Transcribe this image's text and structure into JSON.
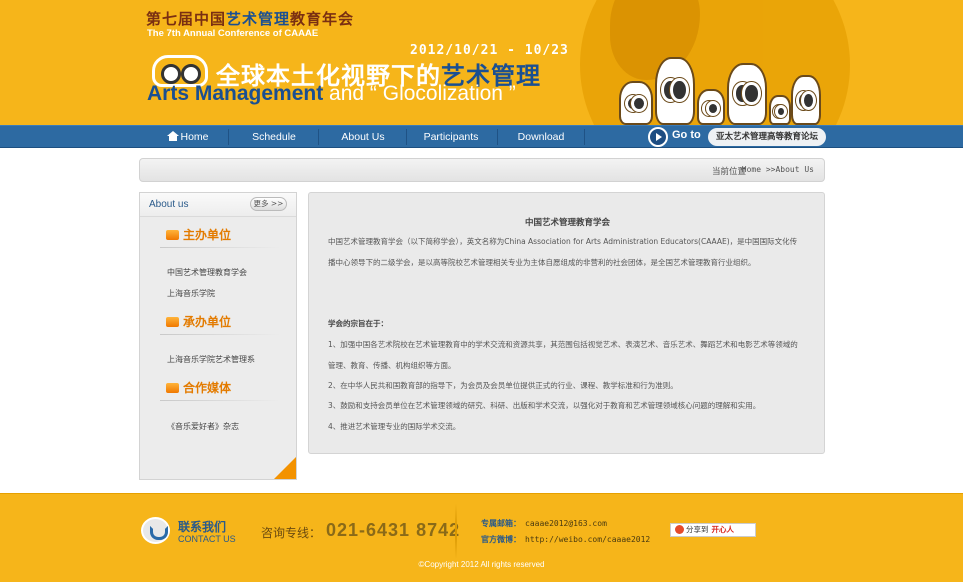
{
  "banner": {
    "title_cn_pre": "第七届中国",
    "title_cn_hl": "艺术管理",
    "title_cn_post": "教育年会",
    "title_en": "The 7th Annual Conference of CAAAE",
    "date": "2012/10/21 - 10/23",
    "theme_cn_pre": "全球本土化视野下的",
    "theme_cn_hl": "艺术管理",
    "theme_en_main": "Arts Management",
    "theme_en_rest": "and “ Glocolization ”"
  },
  "nav": {
    "items": [
      {
        "label": "Home"
      },
      {
        "label": "Schedule"
      },
      {
        "label": "About Us"
      },
      {
        "label": "Participants"
      },
      {
        "label": "Download"
      }
    ],
    "goto_label": "Go to",
    "goto_link": "亚太艺术管理高等教育论坛"
  },
  "breadcrumb": {
    "prefix": "当前位置",
    "path": "Home >>About Us"
  },
  "sidebar": {
    "title": "About us",
    "more": "更多 >>",
    "sections": [
      {
        "title": "主办单位",
        "items": [
          "中国艺术管理教育学会",
          "上海音乐学院"
        ]
      },
      {
        "title": "承办单位",
        "items": [
          "上海音乐学院艺术管理系"
        ]
      },
      {
        "title": "合作媒体",
        "items": [
          "《音乐爱好者》杂志"
        ]
      }
    ]
  },
  "content": {
    "title": "中国艺术管理教育学会",
    "intro": "中国艺术管理教育学会（以下简称学会），英文名称为China Association for Arts Administration Educators(CAAAE)，是中国国际文化传播中心领导下的二级学会，是以高等院校艺术管理相关专业为主体自愿组成的非营利的社会团体，是全国艺术管理教育行业组织。",
    "purpose_heading": "学会的宗旨在于：",
    "points": [
      "1、加强中国各艺术院校在艺术管理教育中的学术交流和资源共享，其范围包括视觉艺术、表演艺术、音乐艺术、舞蹈艺术和电影艺术等领域的管理、教育、传播、机构组织等方面。",
      "2、在中华人民共和国教育部的指导下，为会员及会员单位提供正式的行业、课程、教学标准和行为准则。",
      "3、鼓励和支持会员单位在艺术管理领域的研究、科研、出版和学术交流，以强化对于教育和艺术管理领域核心问题的理解和实用。",
      "4、推进艺术管理专业的国际学术交流。"
    ]
  },
  "footer": {
    "contact_cn": "联系我们",
    "contact_en": "CONTACT US",
    "hotline_label": "咨询专线：",
    "hotline": "021-6431 8742",
    "email_label": "专属邮箱：",
    "email": "caaae2012@163.com",
    "weibo_label": "官方微博：",
    "weibo": "http://weibo.com/caaae2012",
    "share_label": "分享到",
    "share_brand": "开心人",
    "copyright": "©Copyright 2012 All rights reserved"
  }
}
